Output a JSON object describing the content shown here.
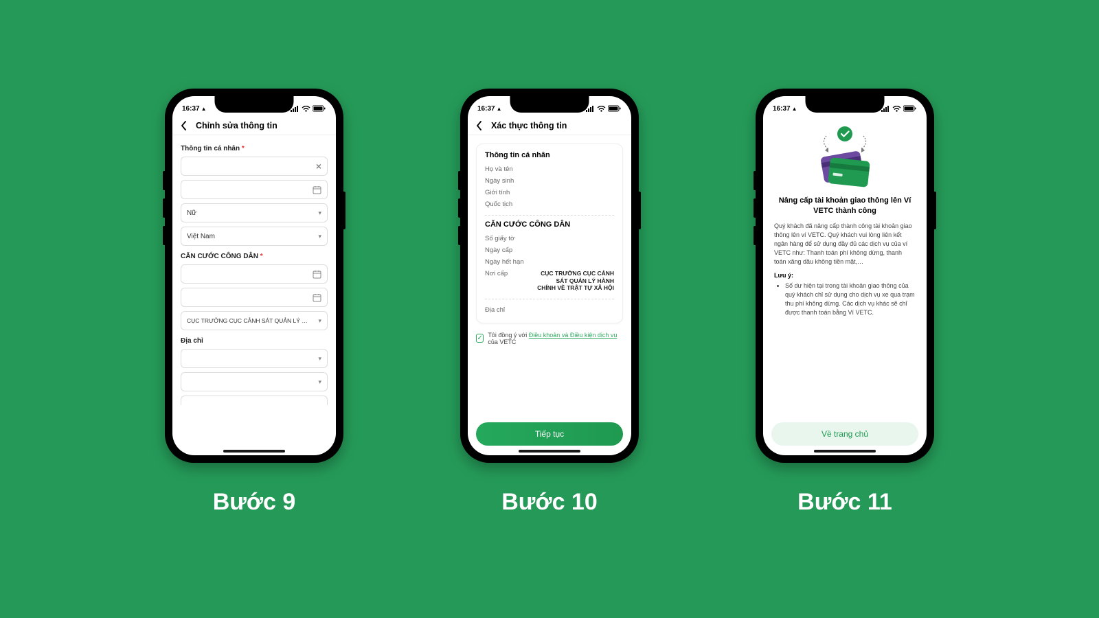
{
  "status": {
    "time": "16:37",
    "user_glyph": "▲"
  },
  "steps": {
    "s9": "Bước 9",
    "s10": "Bước 10",
    "s11": "Bước 11"
  },
  "screen1": {
    "title": "Chỉnh sửa thông tin",
    "sec_personal": "Thông tin cá nhân",
    "gender": "Nữ",
    "nationality": "Việt Nam",
    "sec_id": "CĂN CƯỚC CÔNG DÂN",
    "issuer": "CỤC TRƯỞNG CỤC CẢNH SÁT QUẢN LÝ HÀNH",
    "sec_addr": "Địa chỉ"
  },
  "screen2": {
    "title": "Xác thực thông tin",
    "card1_h": "Thông tin cá nhân",
    "k_name": "Họ và tên",
    "k_dob": "Ngày sinh",
    "k_gender": "Giới tính",
    "k_nat": "Quốc tịch",
    "card2_h": "CĂN CƯỚC CÔNG DÂN",
    "k_idno": "Số giấy tờ",
    "k_issue": "Ngày cấp",
    "k_exp": "Ngày hết hạn",
    "k_place": "Nơi cấp",
    "v_place": "CỤC TRƯỞNG CỤC CẢNH SÁT QUẢN LÝ HÀNH CHÍNH VỀ TRẬT TỰ XÃ HỘI",
    "k_addr": "Địa chỉ",
    "agree_pre": "Tôi đồng ý với ",
    "agree_link": "Điều khoản và Điều kiện dịch vụ",
    "agree_post": " của VETC",
    "btn": "Tiếp tục"
  },
  "screen3": {
    "title": "Nâng cấp tài khoản giao thông lên Ví VETC thành công",
    "body": "Quý khách đã nâng cấp thành công tài khoản giao thông lên ví VETC. Quý khách vui lòng liên kết ngân hàng để sử dụng đầy đủ các dịch vụ của ví VETC như: Thanh toán phí không dừng, thanh toán xăng dầu không tiền mặt,…",
    "note_h": "Lưu ý:",
    "note_item": "Số dư hiện tại trong tài khoản giao thông của quý khách chỉ sử dụng cho dịch vụ xe qua trạm thu phí không dừng. Các dịch vụ khác sẽ chỉ được thanh toán bằng Ví VETC.",
    "btn": "Về trang chủ"
  }
}
